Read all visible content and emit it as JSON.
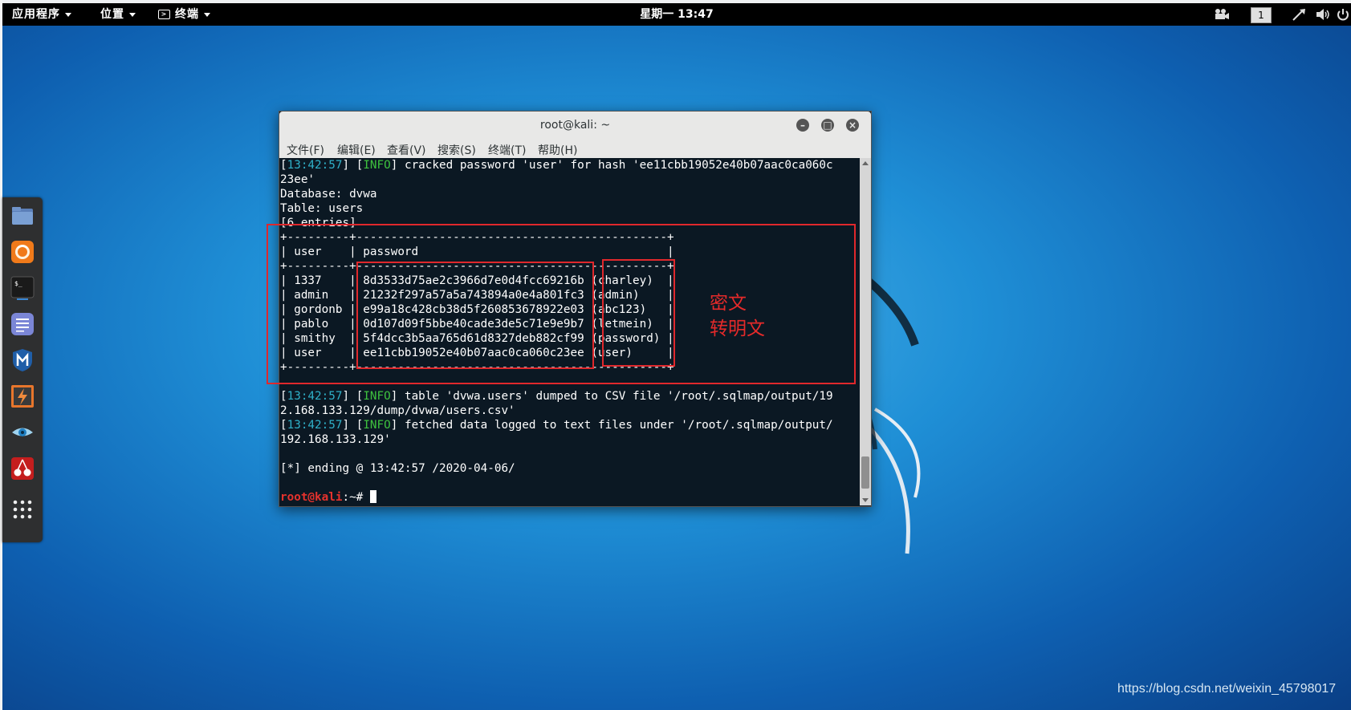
{
  "panel": {
    "applications": "应用程序",
    "places": "位置",
    "terminal": "终端",
    "clock": "星期一 13:47",
    "workspace": "1"
  },
  "dock": {
    "items": [
      "files-icon",
      "firefox-icon",
      "terminal-icon",
      "text-editor-icon",
      "metasploit-icon",
      "burpsuite-icon",
      "eye-icon",
      "cherrytree-icon",
      "app-grid-icon"
    ]
  },
  "terminal": {
    "title": "root@kali: ~",
    "menu": [
      "文件(F)",
      "编辑(E)",
      "查看(V)",
      "搜索(S)",
      "终端(T)",
      "帮助(H)"
    ],
    "lines": [
      {
        "ts": "13:42:57",
        "tag": "INFO",
        "text": " cracked password 'user' for hash 'ee11cbb19052e40b07aac0ca060c"
      },
      {
        "text": "23ee'"
      },
      {
        "text": "Database: dvwa"
      },
      {
        "text": "Table: users"
      },
      {
        "text": "[6 entries]"
      },
      {
        "text": "+---------+---------------------------------------------+"
      },
      {
        "text": "| user    | password                                    |"
      },
      {
        "text": "+---------+---------------------------------------------+"
      },
      {
        "text": "| 1337    | 8d3533d75ae2c3966d7e0d4fcc69216b (charley)  |"
      },
      {
        "text": "| admin   | 21232f297a57a5a743894a0e4a801fc3 (admin)    |"
      },
      {
        "text": "| gordonb | e99a18c428cb38d5f260853678922e03 (abc123)   |"
      },
      {
        "text": "| pablo   | 0d107d09f5bbe40cade3de5c71e9e9b7 (letmein)  |"
      },
      {
        "text": "| smithy  | 5f4dcc3b5aa765d61d8327deb882cf99 (password) |"
      },
      {
        "text": "| user    | ee11cbb19052e40b07aac0ca060c23ee (user)     |"
      },
      {
        "text": "+---------+---------------------------------------------+"
      },
      {
        "text": ""
      },
      {
        "ts": "13:42:57",
        "tag": "INFO",
        "text": " table 'dvwa.users' dumped to CSV file '/root/.sqlmap/output/19"
      },
      {
        "text": "2.168.133.129/dump/dvwa/users.csv'"
      },
      {
        "ts": "13:42:57",
        "tag": "INFO",
        "text": " fetched data logged to text files under '/root/.sqlmap/output/"
      },
      {
        "text": "192.168.133.129'"
      },
      {
        "text": ""
      },
      {
        "text": "[*] ending @ 13:42:57 /2020-04-06/"
      },
      {
        "text": ""
      }
    ],
    "prompt_user": "root@kali",
    "prompt_rest": ":~# "
  },
  "annotation": {
    "line1": "密文",
    "line2": "转明文",
    "color": "#e0282c"
  },
  "watermark": "https://blog.csdn.net/weixin_45798017"
}
